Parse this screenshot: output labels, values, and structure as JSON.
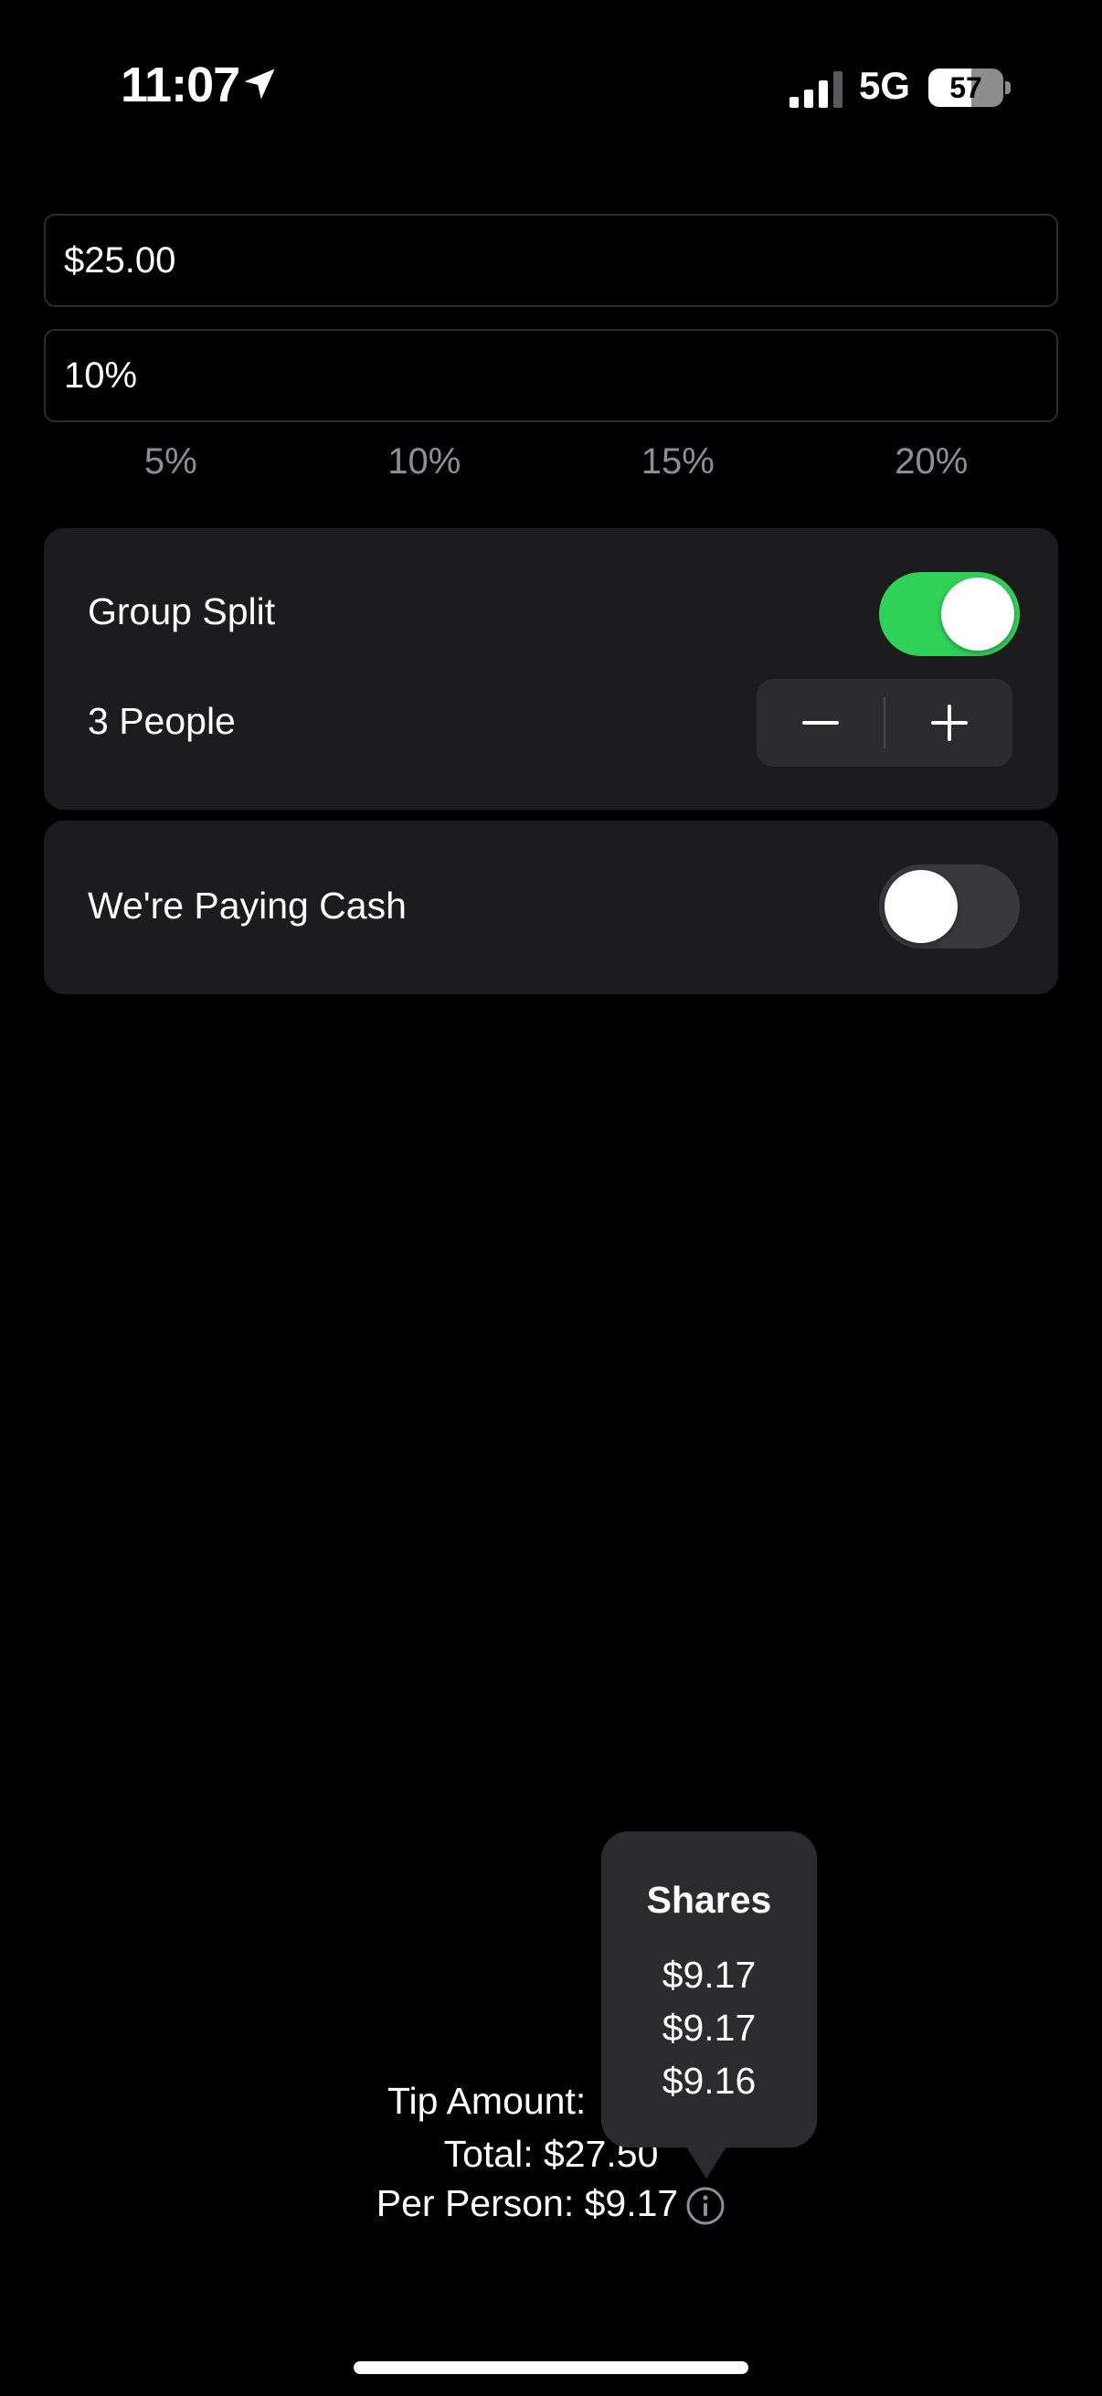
{
  "status_bar": {
    "time": "11:07",
    "network": "5G",
    "battery_percent": "57",
    "battery_level": 0.57,
    "signal_bars": 3,
    "icons": [
      "location-arrow-icon",
      "cellular-signal-icon",
      "battery-icon"
    ]
  },
  "bill": {
    "value": "$25.00"
  },
  "tip": {
    "value": "10%"
  },
  "tip_presets": [
    "5%",
    "10%",
    "15%",
    "20%"
  ],
  "group_split": {
    "label": "Group Split",
    "enabled": true,
    "people_label": "3 People"
  },
  "cash": {
    "label": "We're Paying Cash",
    "enabled": false
  },
  "summary": {
    "tip_amount_text": "Tip Amount:",
    "total_text": "Total: $27.50",
    "per_person_text": "Per Person: $9.17"
  },
  "shares_popover": {
    "title": "Shares",
    "values": [
      "$9.17",
      "$9.17",
      "$9.16"
    ]
  },
  "colors": {
    "accent_green": "#30d158",
    "card_background": "#1c1c1e",
    "secondary_text": "#8e8e93"
  }
}
